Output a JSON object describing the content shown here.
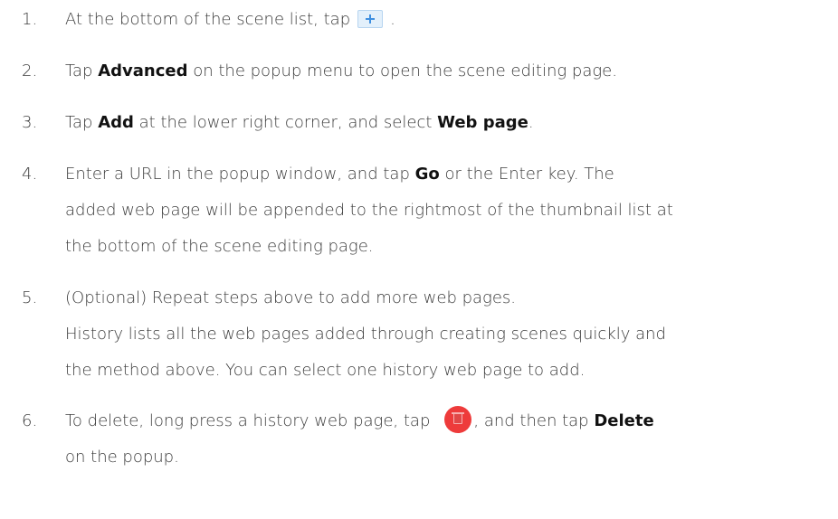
{
  "steps": [
    {
      "num": "1.",
      "before_icon": "At the bottom of the scene list, tap",
      "icon": "plus-button-icon",
      "after_icon": "."
    },
    {
      "num": "2.",
      "pre": "Tap ",
      "bold1": "Advanced",
      "post": " on the popup menu to open the scene editing page."
    },
    {
      "num": "3.",
      "pre": "Tap ",
      "bold1": "Add",
      "mid": " at the lower right corner, and select ",
      "bold2": "Web page",
      "post": "."
    },
    {
      "num": "4.",
      "pre": "Enter a URL in the popup window, and tap ",
      "bold1": "Go",
      "post": " or the Enter key. The",
      "line2": "added web page will be appended to the rightmost of the thumbnail list at",
      "line3": "the bottom of the scene editing page."
    },
    {
      "num": "5.",
      "line1": "(Optional) Repeat steps above to add more web pages.",
      "line2": "History lists all the web pages added through creating scenes quickly and",
      "line3": "the method above. You can select one history web page to add."
    },
    {
      "num": "6.",
      "pre": "To delete, long press a history web page, tap",
      "icon": "trash-button-icon",
      "mid": ", and then tap ",
      "bold1": "Delete",
      "line2": "on the popup."
    }
  ],
  "colors": {
    "text": "#3c3c3c",
    "bold": "#111111",
    "plus_button_bg": "#e3f0fb",
    "plus_button_icon": "#3e8fe0",
    "trash_button_bg": "#ee3b3b"
  }
}
